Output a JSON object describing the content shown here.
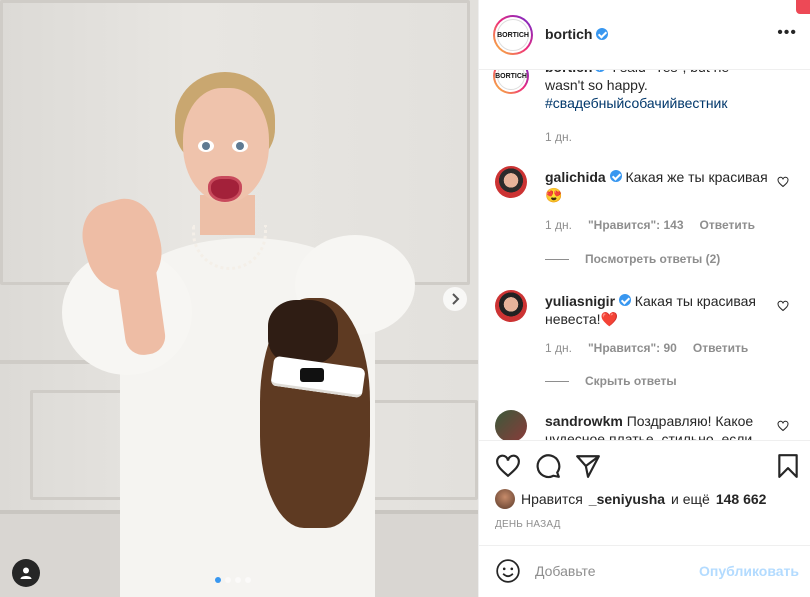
{
  "post": {
    "username": "bortich",
    "avatar_text": "BORTICH",
    "more_icon": "more-horizontal-icon"
  },
  "caption": {
    "username": "bortich",
    "text": " I said \"Yes\", but he wasn't so happy.",
    "hashtag": "#свадебныйсобачийвестник",
    "time": "1 дн."
  },
  "comments": [
    {
      "username": "galichida",
      "text": " Какая же ты красивая😍",
      "time": "1 дн.",
      "likes": "\"Нравится\": 143",
      "reply": "Ответить",
      "replies_toggle": "Посмотреть ответы (2)"
    },
    {
      "username": "yuliasnigir",
      "text": " Какая ты красивая невеста!❤️",
      "time": "1 дн.",
      "likes": "\"Нравится\": 90",
      "reply": "Ответить",
      "replies_toggle": "Скрыть ответы"
    },
    {
      "username": "sandrowkm",
      "text": " Поздравляю! Какое чудесное платье, стильно, если"
    }
  ],
  "actions": {
    "likes_prefix": "Нравится",
    "likes_user": "_seniyusha",
    "likes_suffix": "и ещё",
    "likes_count": "148 662",
    "date": "ДЕНЬ НАЗАД"
  },
  "add_comment": {
    "placeholder": "Добавьте",
    "publish_label": "Опубликовать"
  },
  "carousel": {
    "slide_count": 4,
    "active_index": 0
  },
  "colors": {
    "accent": "#3897f0",
    "like_red": "#ed4956",
    "hashtag": "#00376b",
    "muted": "#8e8e8e",
    "publish_disabled": "#b3dbff"
  }
}
